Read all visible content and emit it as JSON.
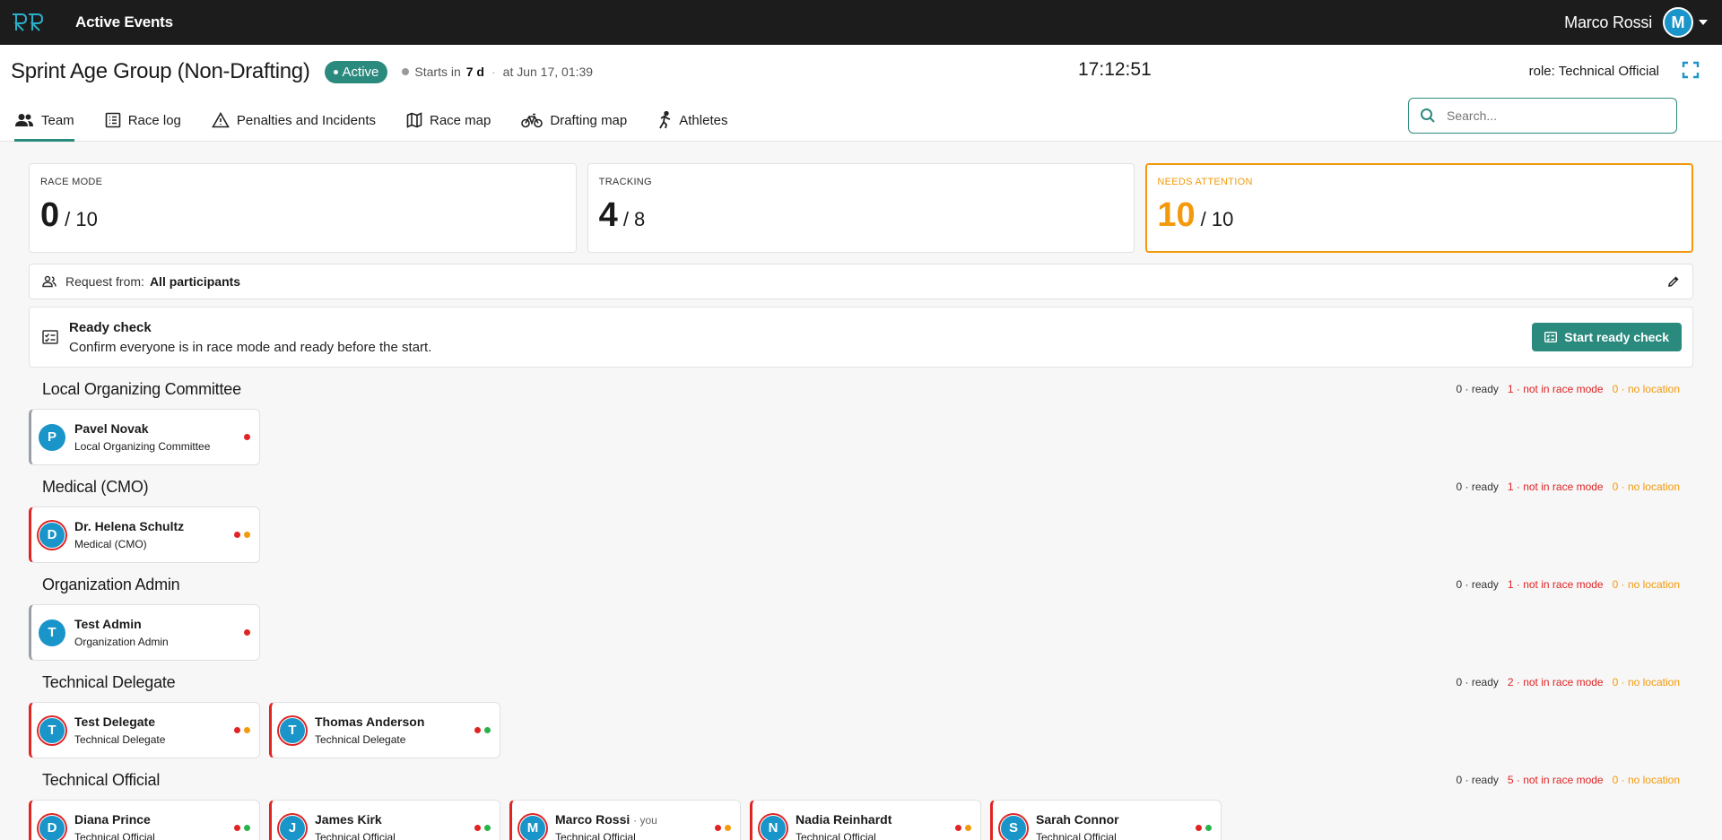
{
  "topbar": {
    "app_title": "Active Events",
    "user_name": "Marco Rossi",
    "user_initial": "M"
  },
  "event": {
    "title": "Sprint Age Group (Non-Drafting)",
    "status": "Active",
    "starts_label": "Starts in",
    "starts_value": "7 d",
    "starts_at": "at Jun 17, 01:39",
    "clock": "17:12:51",
    "role": "role: Technical Official"
  },
  "tabs": [
    {
      "label": "Team",
      "icon": "team-icon",
      "active": true
    },
    {
      "label": "Race log",
      "icon": "list-icon"
    },
    {
      "label": "Penalties and Incidents",
      "icon": "warning-icon"
    },
    {
      "label": "Race map",
      "icon": "map-icon"
    },
    {
      "label": "Drafting map",
      "icon": "bike-icon"
    },
    {
      "label": "Athletes",
      "icon": "runner-icon"
    }
  ],
  "search": {
    "placeholder": "Search..."
  },
  "stats": [
    {
      "label": "RACE MODE",
      "value": "0",
      "total": "/ 10"
    },
    {
      "label": "TRACKING",
      "value": "4",
      "total": "/ 8"
    },
    {
      "label": "NEEDS ATTENTION",
      "value": "10",
      "total": "/ 10"
    }
  ],
  "request": {
    "label": "Request from:",
    "value": "All participants"
  },
  "ready_check": {
    "title": "Ready check",
    "subtitle": "Confirm everyone is in race mode and ready before the start.",
    "button": "Start ready check"
  },
  "groups": [
    {
      "title": "Local Organizing Committee",
      "ready": "0 · ready",
      "race": "1 · not in race mode",
      "loc": "0 · no location",
      "members": [
        {
          "initial": "P",
          "name": "Pavel Novak",
          "role": "Local Organizing Committee",
          "alert": false,
          "dots": [
            "r"
          ]
        }
      ]
    },
    {
      "title": "Medical (CMO)",
      "ready": "0 · ready",
      "race": "1 · not in race mode",
      "loc": "0 · no location",
      "members": [
        {
          "initial": "D",
          "name": "Dr. Helena Schultz",
          "role": "Medical (CMO)",
          "alert": true,
          "dots": [
            "r",
            "o"
          ]
        }
      ]
    },
    {
      "title": "Organization Admin",
      "ready": "0 · ready",
      "race": "1 · not in race mode",
      "loc": "0 · no location",
      "members": [
        {
          "initial": "T",
          "name": "Test Admin",
          "role": "Organization Admin",
          "alert": false,
          "dots": [
            "r"
          ]
        }
      ]
    },
    {
      "title": "Technical Delegate",
      "ready": "0 · ready",
      "race": "2 · not in race mode",
      "loc": "0 · no location",
      "members": [
        {
          "initial": "T",
          "name": "Test Delegate",
          "role": "Technical Delegate",
          "alert": true,
          "dots": [
            "r",
            "o"
          ]
        },
        {
          "initial": "T",
          "name": "Thomas Anderson",
          "role": "Technical Delegate",
          "alert": true,
          "dots": [
            "r",
            "g"
          ]
        }
      ]
    },
    {
      "title": "Technical Official",
      "ready": "0 · ready",
      "race": "5 · not in race mode",
      "loc": "0 · no location",
      "members": [
        {
          "initial": "D",
          "name": "Diana Prince",
          "role": "Technical Official",
          "alert": true,
          "dots": [
            "r",
            "g"
          ]
        },
        {
          "initial": "J",
          "name": "James Kirk",
          "role": "Technical Official",
          "alert": true,
          "dots": [
            "r",
            "g"
          ]
        },
        {
          "initial": "M",
          "name": "Marco Rossi",
          "you": "· you",
          "role": "Technical Official",
          "alert": true,
          "dots": [
            "r",
            "o"
          ]
        },
        {
          "initial": "N",
          "name": "Nadia Reinhardt",
          "role": "Technical Official",
          "alert": true,
          "dots": [
            "r",
            "o"
          ]
        },
        {
          "initial": "S",
          "name": "Sarah Connor",
          "role": "Technical Official",
          "alert": true,
          "dots": [
            "r",
            "g"
          ]
        }
      ]
    }
  ],
  "colors": {
    "accent": "#2b8a7e",
    "warning": "#f39a0c",
    "danger": "#e02424",
    "ok": "#2bb34b",
    "avatar": "#1a95c9",
    "topbar": "#1c1c1c"
  }
}
